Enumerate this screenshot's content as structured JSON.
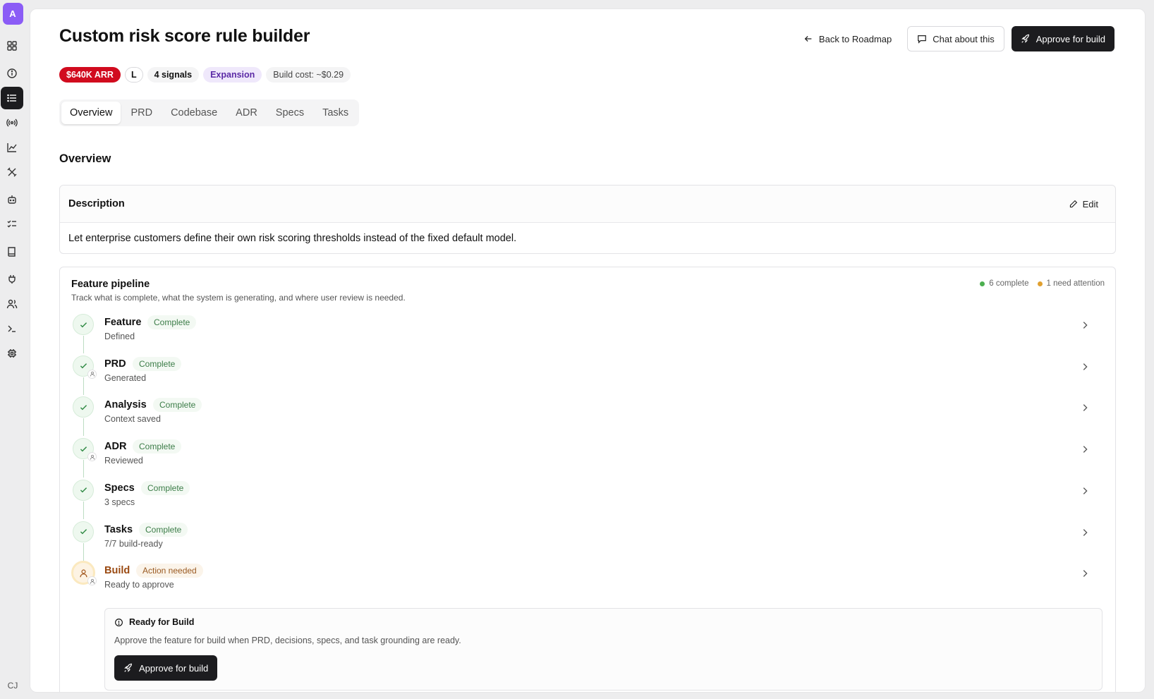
{
  "rail": {
    "logo_letter": "A",
    "user_initials": "CJ",
    "icons": [
      "grid-icon",
      "info-icon",
      "list-icon",
      "broadcast-icon",
      "chart-line-icon",
      "tools-icon",
      "robot-icon",
      "checklist-icon",
      "book-icon",
      "plug-icon",
      "users-icon",
      "terminal-icon",
      "chip-icon"
    ],
    "active_icon": "list-icon"
  },
  "header": {
    "title": "Custom risk score rule builder",
    "back_label": "Back to Roadmap",
    "chat_label": "Chat about this",
    "approve_label": "Approve for build"
  },
  "badges": {
    "arr": "$640K ARR",
    "size": "L",
    "signals": "4 signals",
    "category": "Expansion",
    "cost": "Build cost: ~$0.29"
  },
  "tabs": [
    "Overview",
    "PRD",
    "Codebase",
    "ADR",
    "Specs",
    "Tasks"
  ],
  "active_tab": "Overview",
  "section_title": "Overview",
  "description": {
    "label": "Description",
    "edit_label": "Edit",
    "text": "Let enterprise customers define their own risk scoring thresholds instead of the fixed default model."
  },
  "pipeline": {
    "title": "Feature pipeline",
    "subtitle": "Track what is complete, what the system is generating, and where user review is needed.",
    "legend_complete": "6 complete",
    "legend_attention": "1 need attention",
    "colors": {
      "complete": "#4caf50",
      "attention": "#e0a030"
    },
    "steps": [
      {
        "name": "Feature",
        "status": "Complete",
        "detail": "Defined",
        "state": "complete",
        "user_icon": false
      },
      {
        "name": "PRD",
        "status": "Complete",
        "detail": "Generated",
        "state": "complete",
        "user_icon": true
      },
      {
        "name": "Analysis",
        "status": "Complete",
        "detail": "Context saved",
        "state": "complete",
        "user_icon": false
      },
      {
        "name": "ADR",
        "status": "Complete",
        "detail": "Reviewed",
        "state": "complete",
        "user_icon": true
      },
      {
        "name": "Specs",
        "status": "Complete",
        "detail": "3 specs",
        "state": "complete",
        "user_icon": false
      },
      {
        "name": "Tasks",
        "status": "Complete",
        "detail": "7/7 build-ready",
        "state": "complete",
        "user_icon": false
      },
      {
        "name": "Build",
        "status": "Action needed",
        "detail": "Ready to approve",
        "state": "attention",
        "user_icon": true
      }
    ],
    "ready": {
      "title": "Ready for Build",
      "text": "Approve the feature for build when PRD, decisions, specs, and task grounding are ready.",
      "button_label": "Approve for build"
    }
  }
}
